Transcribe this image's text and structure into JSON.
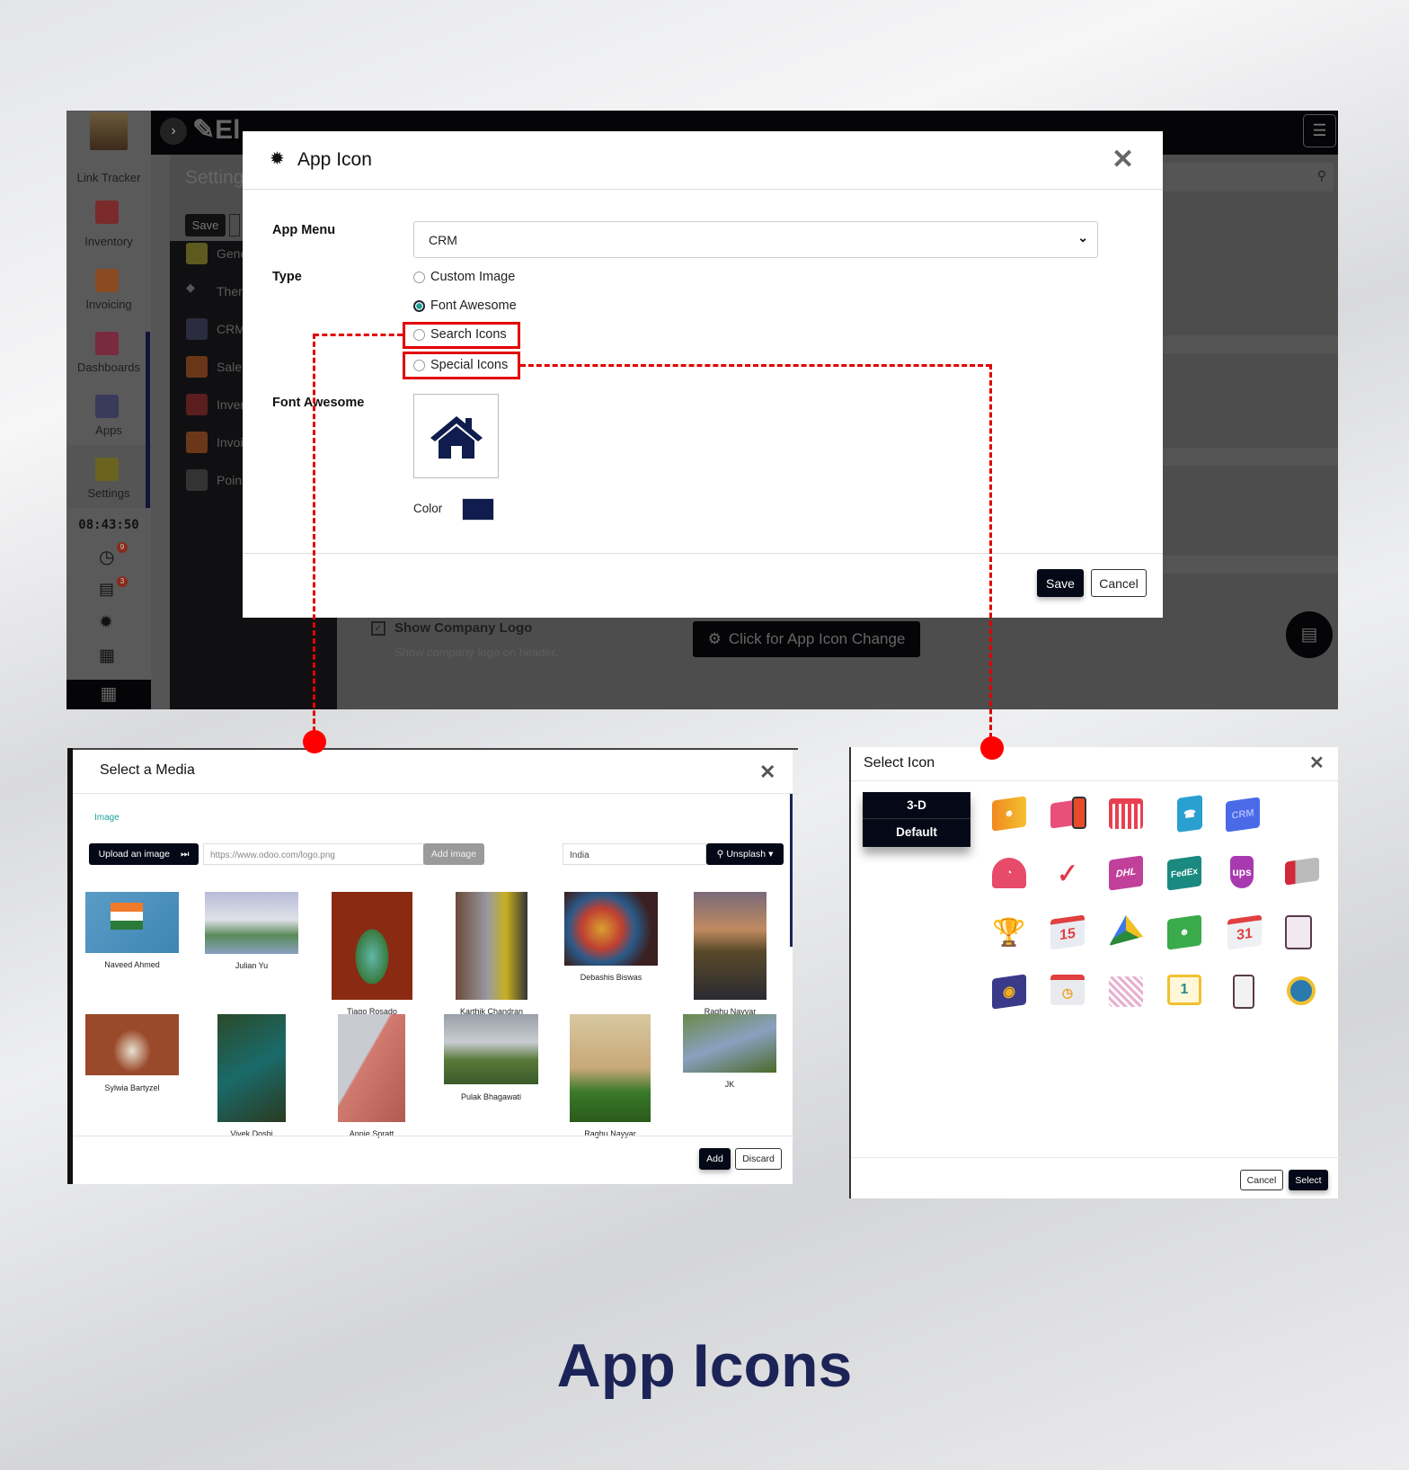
{
  "app_screenshot": {
    "sidebar": {
      "items": [
        {
          "label": "Link Tracker"
        },
        {
          "label": "Inventory"
        },
        {
          "label": "Invoicing"
        },
        {
          "label": "Dashboards"
        },
        {
          "label": "Apps"
        },
        {
          "label": "Settings"
        }
      ],
      "clock": "08:43:50",
      "badges": {
        "activity": "9",
        "messages": "3"
      }
    },
    "brand_partial": "El",
    "page_title_partial": "Setting",
    "save_label": "Save",
    "settings_menu": [
      "Gene",
      "Ther",
      "CRM",
      "Sale",
      "Inver",
      "Invoi",
      "Poin"
    ],
    "show_company_logo": {
      "label": "Show Company Logo",
      "help": "Show company logo on header.",
      "checked": true
    },
    "app_icon_change_label": "Click for App Icon Change"
  },
  "app_icon_dialog": {
    "title": "App Icon",
    "app_menu_label": "App Menu",
    "app_menu_value": "CRM",
    "type_label": "Type",
    "type_options": [
      "Custom Image",
      "Font Awesome",
      "Search Icons",
      "Special Icons"
    ],
    "selected_type": "Font Awesome",
    "font_awesome_label": "Font Awesome",
    "icon": "home-icon",
    "color_label": "Color",
    "color": "#0f1c4d",
    "save": "Save",
    "cancel": "Cancel"
  },
  "media_dialog": {
    "title": "Select a Media",
    "tab": "Image",
    "upload": "Upload an image",
    "url_placeholder": "https://www.odoo.com/logo.png",
    "add_image": "Add image",
    "search_value": "India",
    "source": "Unsplash",
    "images": [
      "Naveed Ahmed",
      "Julian Yu",
      "Tiago Rosado",
      "Karthik Chandran",
      "Debashis Biswas",
      "Raghu Nayyar",
      "Sylwia Bartyzel",
      "Vivek Doshi",
      "Annie Spratt",
      "Pulak Bhagawati",
      "Raghu Nayyar",
      "JK"
    ],
    "add": "Add",
    "discard": "Discard"
  },
  "icon_dialog": {
    "title": "Select Icon",
    "categories": [
      "3-D",
      "Default"
    ],
    "icon_labels": {
      "crm": "CRM",
      "dhl": "DHL",
      "fedex": "FedEx",
      "ups": "ups",
      "cal15": "15",
      "cal31": "31",
      "cal1": "1"
    },
    "cancel": "Cancel",
    "select": "Select"
  },
  "headline": "App Icons",
  "colors": {
    "accent": "#e30000",
    "navy": "#1c2457",
    "dark": "#050816",
    "teal": "#1aa39a"
  }
}
